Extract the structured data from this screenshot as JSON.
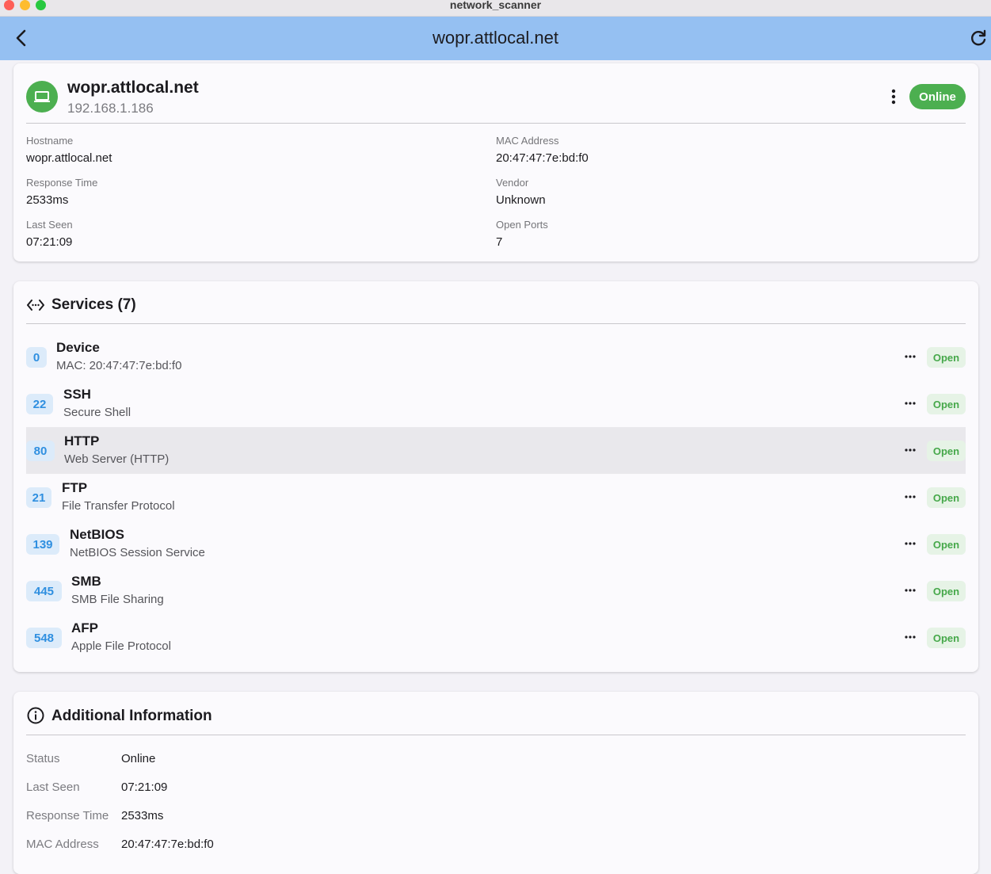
{
  "window": {
    "title": "network_scanner"
  },
  "appbar": {
    "title": "wopr.attlocal.net",
    "back_icon": "chevron-left-icon",
    "refresh_icon": "refresh-icon"
  },
  "device": {
    "name": "wopr.attlocal.net",
    "ip": "192.168.1.186",
    "status": "Online",
    "status_color": "#4caf50",
    "icon": "laptop-icon",
    "fields": {
      "hostname_label": "Hostname",
      "hostname": "wopr.attlocal.net",
      "mac_label": "MAC Address",
      "mac": "20:47:47:7e:bd:f0",
      "response_label": "Response Time",
      "response": "2533ms",
      "vendor_label": "Vendor",
      "vendor": "Unknown",
      "last_seen_label": "Last Seen",
      "last_seen": "07:21:09",
      "ports_label": "Open Ports",
      "ports": "7"
    }
  },
  "services": {
    "title": "Services (7)",
    "icon": "code-arrows-icon",
    "items": [
      {
        "port": "0",
        "name": "Device",
        "desc": "MAC: 20:47:47:7e:bd:f0",
        "state": "Open"
      },
      {
        "port": "22",
        "name": "SSH",
        "desc": "Secure Shell",
        "state": "Open"
      },
      {
        "port": "80",
        "name": "HTTP",
        "desc": "Web Server (HTTP)",
        "state": "Open"
      },
      {
        "port": "21",
        "name": "FTP",
        "desc": "File Transfer Protocol",
        "state": "Open"
      },
      {
        "port": "139",
        "name": "NetBIOS",
        "desc": "NetBIOS Session Service",
        "state": "Open"
      },
      {
        "port": "445",
        "name": "SMB",
        "desc": "SMB File Sharing",
        "state": "Open"
      },
      {
        "port": "548",
        "name": "AFP",
        "desc": "Apple File Protocol",
        "state": "Open"
      }
    ]
  },
  "additional": {
    "title": "Additional Information",
    "icon": "info-icon",
    "rows": [
      {
        "label": "Status",
        "value": "Online"
      },
      {
        "label": "Last Seen",
        "value": "07:21:09"
      },
      {
        "label": "Response Time",
        "value": "2533ms"
      },
      {
        "label": "MAC Address",
        "value": "20:47:47:7e:bd:f0"
      }
    ]
  },
  "colors": {
    "appbar": "#95c0f2",
    "port_badge_text": "#2f8fe0",
    "open_badge_text": "#46a84a"
  }
}
